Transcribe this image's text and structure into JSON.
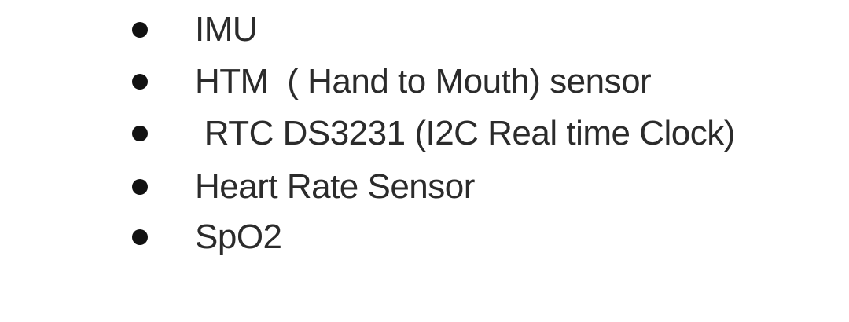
{
  "list": {
    "items": [
      {
        "label": "IMU"
      },
      {
        "label": "HTM  ( Hand to Mouth) sensor"
      },
      {
        "label": " RTC DS3231 (I2C Real time Clock)"
      },
      {
        "label": "Heart Rate Sensor"
      },
      {
        "label": "SpO2"
      }
    ]
  },
  "colors": {
    "text": "#2b2b2b",
    "bullet": "#111111",
    "background": "#ffffff"
  }
}
